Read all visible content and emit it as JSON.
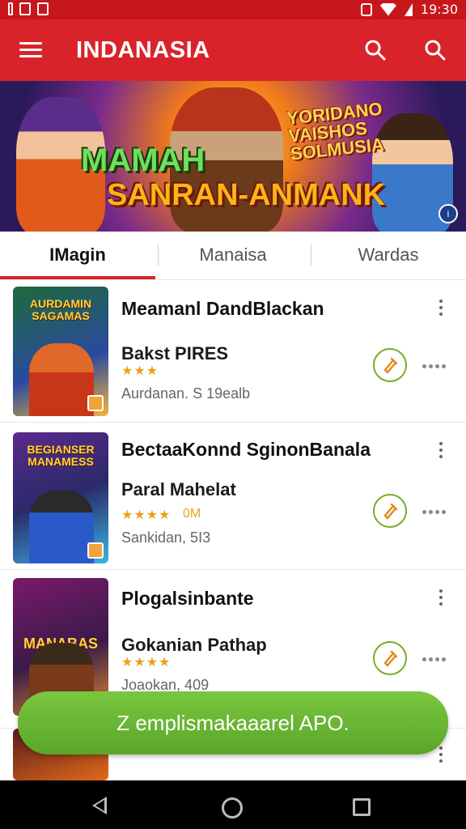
{
  "status_bar": {
    "time": "19:30"
  },
  "app_bar": {
    "title": "INDANASIA"
  },
  "banner": {
    "headline_1": "MAMAH",
    "headline_2": "SANRAN-ANMANK",
    "logo_text": "YORIDANO VAISHOS SOLMUSIA"
  },
  "tabs": [
    {
      "label": "IMagin",
      "active": true
    },
    {
      "label": "Manaisa",
      "active": false
    },
    {
      "label": "Wardas",
      "active": false
    }
  ],
  "items": [
    {
      "thumb_title": "AURDAMIN SAGAMAS",
      "title": "Meamanl DandBlackan",
      "subtitle": "Bakst PIRES",
      "rating_text": "",
      "stars": "★★★",
      "meta": "Aurdanan. S 19ealb",
      "thumb_colors": [
        "#1d6a3a",
        "#f0b43a"
      ]
    },
    {
      "thumb_title": "BEGIANSER MANAMESS",
      "title": "BectaaKonnd SginonBanala",
      "subtitle": "Paral Mahelat",
      "rating_text": "0M",
      "stars": "★★★★",
      "meta": "Sankidan, 5I3",
      "thumb_colors": [
        "#5a2a8a",
        "#3bb3e0"
      ]
    },
    {
      "thumb_title": "MANABAS",
      "title": "Plogalsinbante",
      "subtitle": "Gokanian Pathap",
      "rating_text": "",
      "stars": "★★★★",
      "meta": "Joaokan, 409",
      "thumb_colors": [
        "#7a1a6a",
        "#e08a2a"
      ]
    }
  ],
  "snackbar": {
    "text": "Z emplismakaaarel APO."
  },
  "accent_color": "#d9232a",
  "snackbar_color": "#6bb834"
}
